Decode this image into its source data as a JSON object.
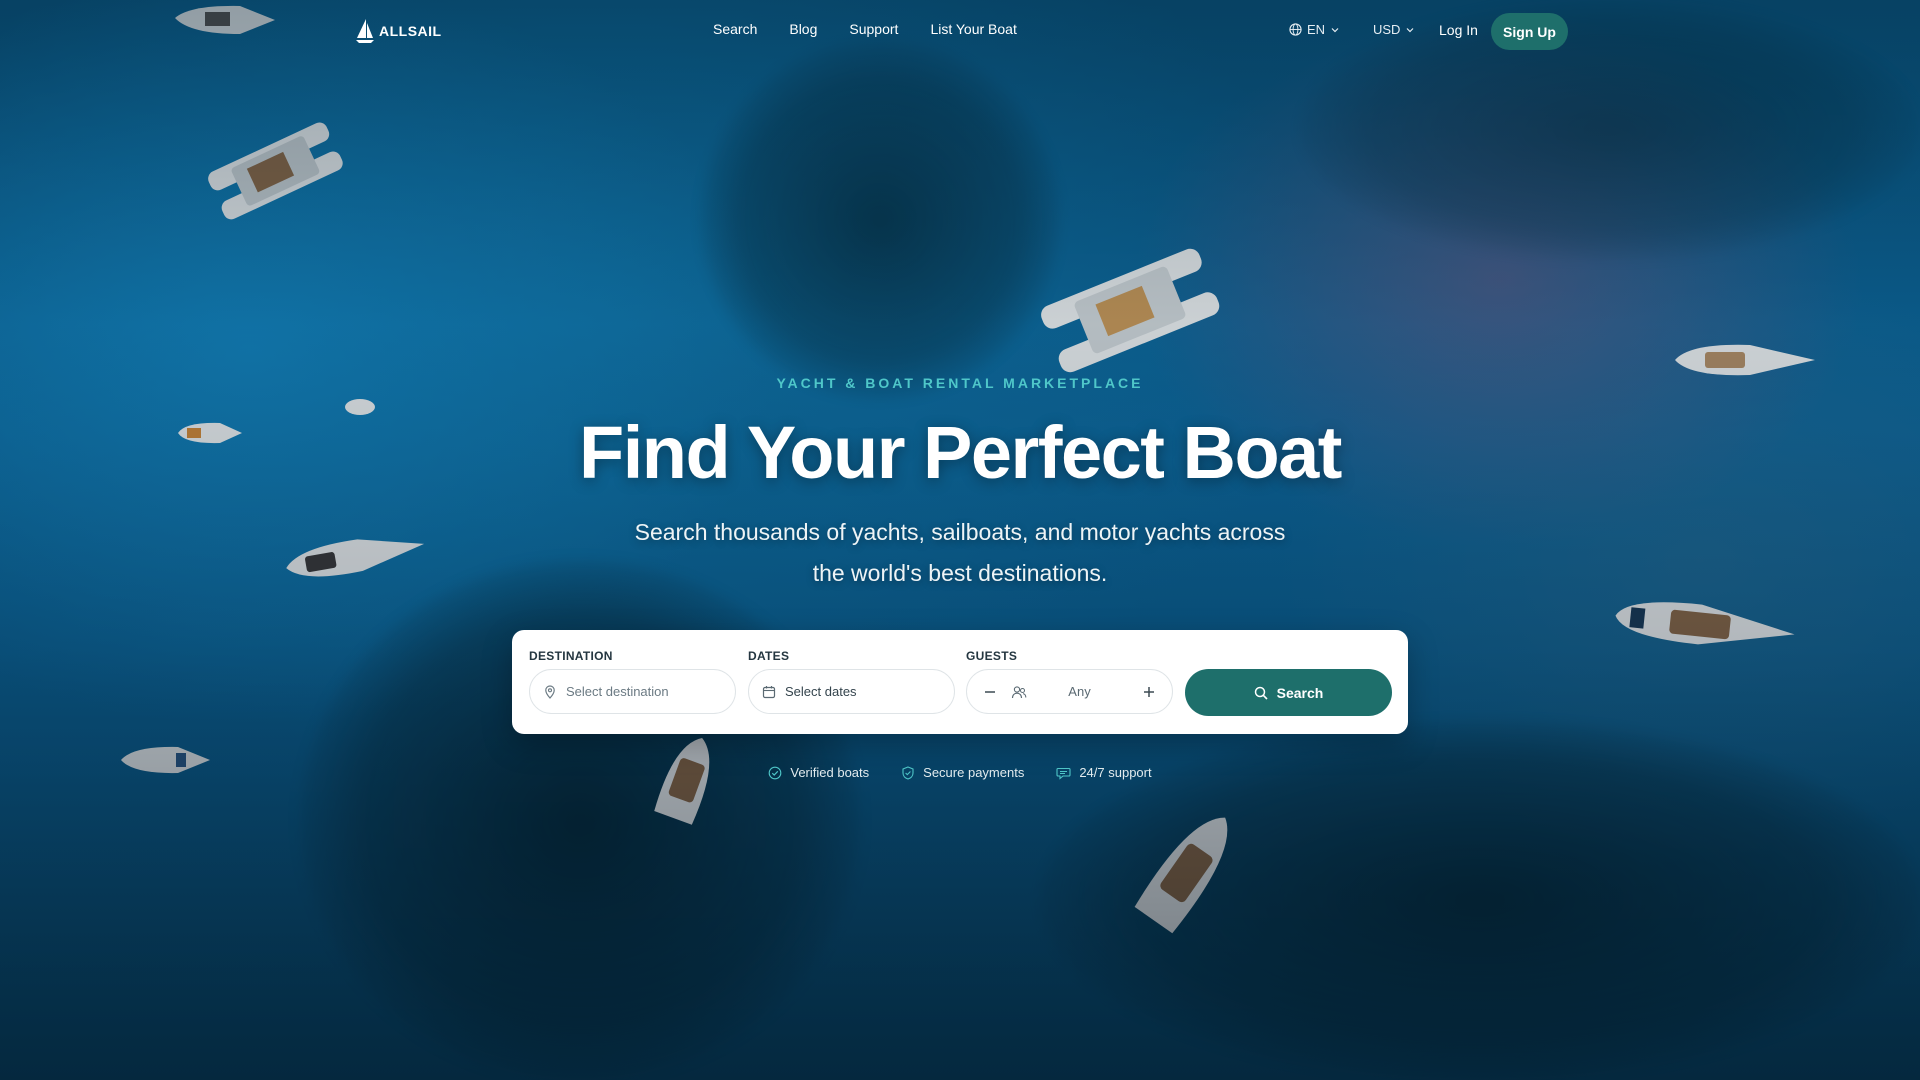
{
  "brand": {
    "name": "ALLSAIL"
  },
  "nav": {
    "items": [
      "Search",
      "Blog",
      "Support",
      "List Your Boat"
    ]
  },
  "header": {
    "language": "EN",
    "currency": "USD",
    "login_label": "Log In",
    "signup_label": "Sign Up"
  },
  "hero": {
    "eyebrow": "YACHT & BOAT RENTAL MARKETPLACE",
    "title": "Find Your Perfect Boat",
    "subtitle": "Search thousands of yachts, sailboats, and motor yachts across the world's best destinations."
  },
  "search": {
    "destination_label": "DESTINATION",
    "destination_placeholder": "Select destination",
    "dates_label": "DATES",
    "dates_value": "Select dates",
    "guests_label": "GUESTS",
    "guests_value": "Any",
    "button_label": "Search"
  },
  "badges": [
    "Verified boats",
    "Secure payments",
    "24/7 support"
  ],
  "colors": {
    "accent": "#1e6f6b",
    "eyebrow": "#4fc7c9"
  },
  "icons": [
    "sail-logo-icon",
    "globe-icon",
    "chevron-down-icon",
    "location-pin-icon",
    "calendar-icon",
    "minus-icon",
    "people-icon",
    "plus-icon",
    "search-icon",
    "check-circle-icon",
    "shield-check-icon",
    "chat-icon"
  ]
}
